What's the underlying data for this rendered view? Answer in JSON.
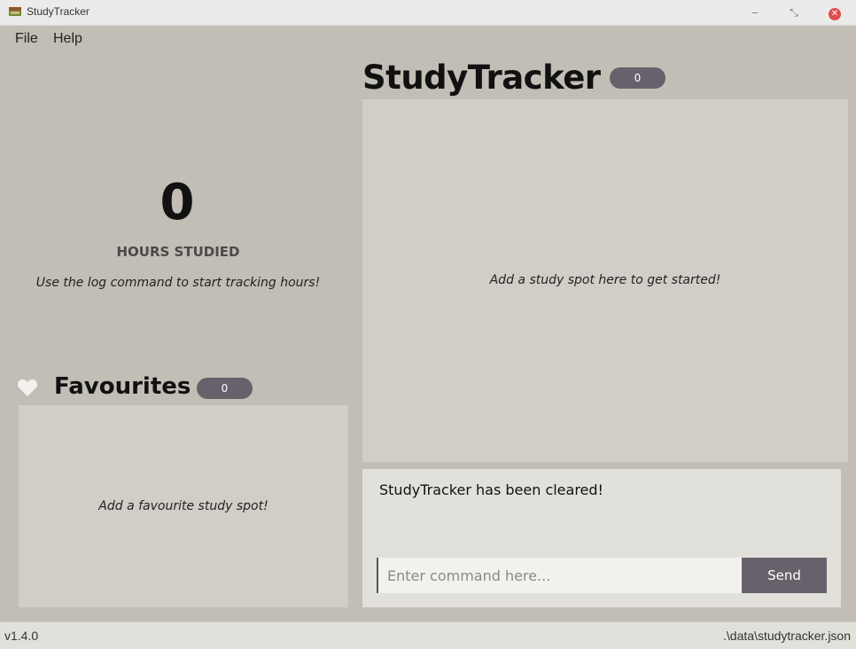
{
  "window": {
    "title": "StudyTracker",
    "minimize_glyph": "‒",
    "maximize_glyph": "⤡",
    "close_glyph": "✕"
  },
  "menu": {
    "file": "File",
    "help": "Help"
  },
  "hours": {
    "value": "0",
    "label": "HOURS STUDIED",
    "hint": "Use the log command to start tracking hours!"
  },
  "favourites": {
    "title": "Favourites",
    "count": "0",
    "empty_text": "Add a favourite study spot!",
    "icon": "heart-icon"
  },
  "main": {
    "title": "StudyTracker",
    "count": "0",
    "empty_text": "Add a study spot here to get started!"
  },
  "result": {
    "message": "StudyTracker has been cleared!"
  },
  "command": {
    "placeholder": "Enter command here...",
    "send_label": "Send"
  },
  "status": {
    "version": "v1.4.0",
    "file_path": ".\\data\\studytracker.json"
  },
  "colors": {
    "background": "#c2beb5",
    "panel": "#d1cec7",
    "pill": "#67616b",
    "close_button": "#e34d4d"
  }
}
